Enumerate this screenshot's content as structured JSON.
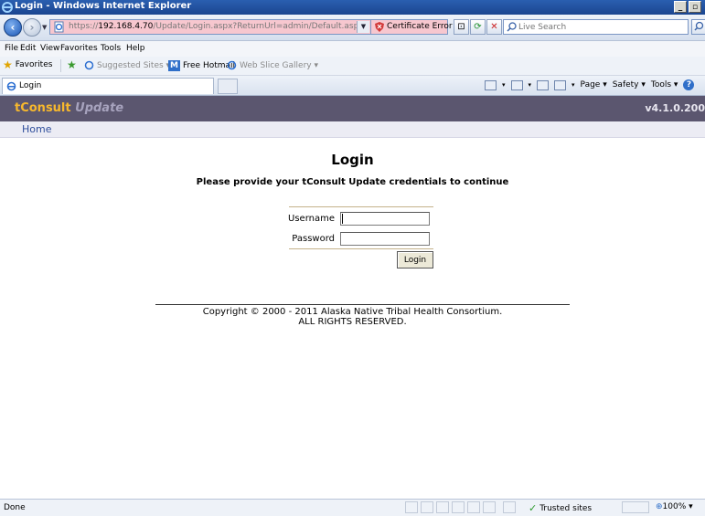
{
  "window": {
    "title": "Login - Windows Internet Explorer"
  },
  "address_bar": {
    "url_prefix": "https://",
    "url_host": "192.168.4.70",
    "url_path": "/Update/Login.aspx?ReturnUrl=admin/Default.aspx",
    "cert_error": "Certificate Error",
    "search_placeholder": "Live Search"
  },
  "menu": {
    "items": [
      "File",
      "Edit",
      "View",
      "Favorites",
      "Tools",
      "Help"
    ]
  },
  "favorites_bar": {
    "favorites": "Favorites",
    "suggested_sites": "Suggested Sites ▾",
    "free_hotmail": "Free Hotmail",
    "web_slice_gallery": "Web Slice Gallery ▾"
  },
  "tabs": {
    "active_tab": "Login"
  },
  "command_bar": {
    "page": "Page ▾",
    "safety": "Safety ▾",
    "tools": "Tools ▾"
  },
  "app": {
    "brand_main": "tConsult",
    "brand_sub": "Update",
    "version": "v4.1.0.200",
    "nav_home": "Home"
  },
  "login": {
    "title": "Login",
    "subtitle": "Please provide your tConsult Update credentials to continue",
    "username_label": "Username",
    "password_label": "Password",
    "username_value": "",
    "password_value": "",
    "button_label": "Login"
  },
  "footer": {
    "copyright_line1": "Copyright © 2000 - 2011 Alaska Native Tribal Health Consortium.",
    "copyright_line2": "ALL RIGHTS RESERVED."
  },
  "status_bar": {
    "status": "Done",
    "zone": "Trusted sites",
    "zoom": "100%"
  },
  "colors": {
    "header_bg": "#5b566f",
    "brand_accent": "#f7b82d",
    "brand_sub": "#a7a3be",
    "nav_link": "#2f4e9c",
    "cert_error_bg": "#f7c7cf"
  }
}
